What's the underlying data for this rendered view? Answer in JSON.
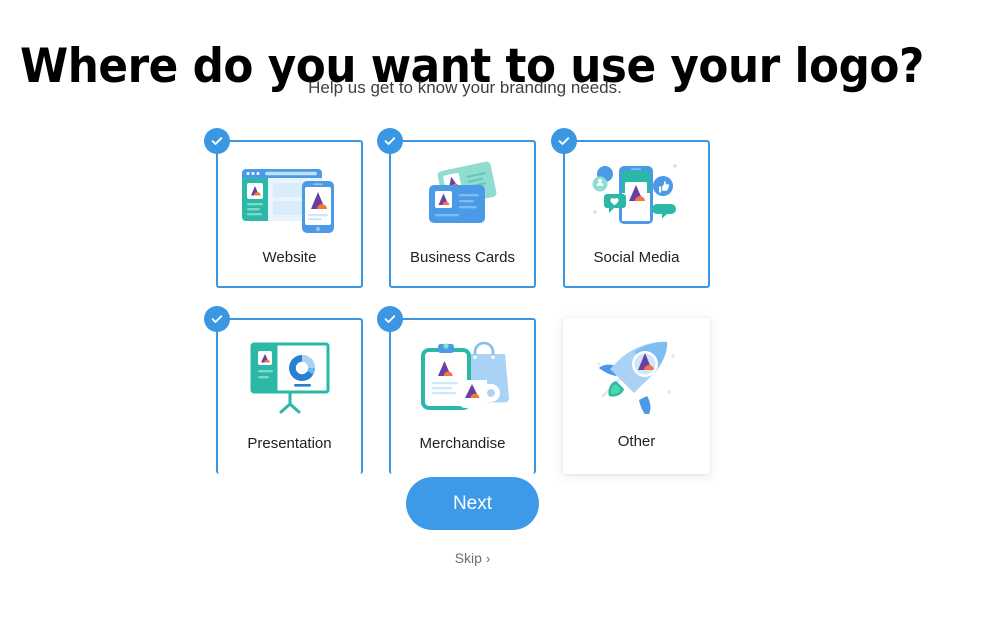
{
  "header": {
    "title": "Where do you want to use your logo?",
    "subtitle": "Help us get to know your branding needs."
  },
  "colors": {
    "accent_blue": "#3b97e3",
    "button_blue": "#3d9ae8",
    "card_border_selected": "#3b97e3",
    "text_primary": "#202124",
    "text_secondary": "#3c4043",
    "skip_gray": "#6b7075",
    "illustration_teal": "#2bb8a6",
    "illustration_blue": "#4a9ae8",
    "illustration_light_blue": "#a9d2f5",
    "logo_purple": "#6b3fa0",
    "logo_orange": "#f2773f"
  },
  "options": [
    {
      "label": "Website",
      "icon": "website-illustration",
      "selected": true
    },
    {
      "label": "Business Cards",
      "icon": "business-cards-illustration",
      "selected": true
    },
    {
      "label": "Social Media",
      "icon": "social-media-illustration",
      "selected": true
    },
    {
      "label": "Presentation",
      "icon": "presentation-illustration",
      "selected": true
    },
    {
      "label": "Merchandise",
      "icon": "merchandise-illustration",
      "selected": true
    },
    {
      "label": "Other",
      "icon": "rocket-illustration",
      "selected": false
    }
  ],
  "footer": {
    "next_label": "Next",
    "skip_label": "Skip",
    "skip_chevron": "›"
  },
  "check_icon": "check-icon"
}
